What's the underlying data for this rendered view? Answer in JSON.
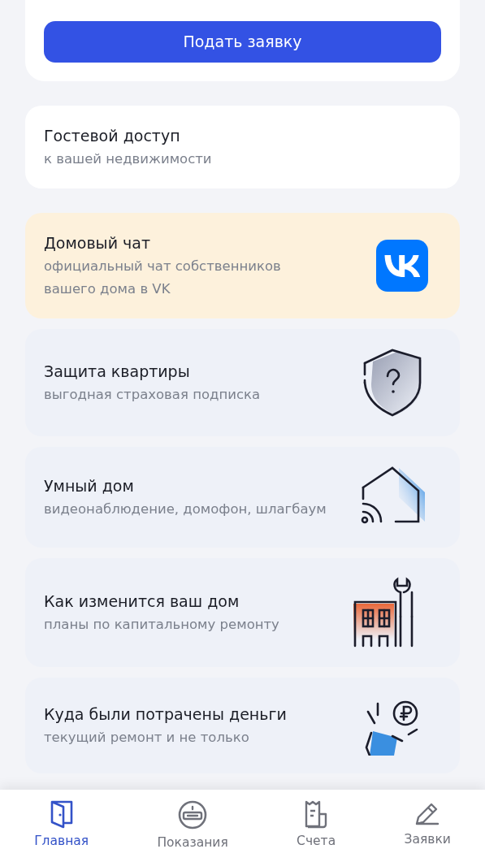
{
  "apply_button": "Подать заявку",
  "cards": [
    {
      "kind": "guest",
      "title": "Гостевой доступ",
      "subtitle": "к вашей недвижимости"
    },
    {
      "kind": "vk",
      "title": "Домовый чат",
      "subtitle": "официальный чат собственников вашего дома в VK"
    },
    {
      "kind": "shield",
      "title": "Защита квартиры",
      "subtitle": "выгодная страховая подписка"
    },
    {
      "kind": "smarthome",
      "title": "Умный дом",
      "subtitle": "видеонаблюдение, домофон, шлагбаум"
    },
    {
      "kind": "renovation",
      "title": "Как изменится ваш дом",
      "subtitle": "планы по капитальному ремонту"
    },
    {
      "kind": "money",
      "title": "Куда были потрачены деньги",
      "subtitle": "текущий ремонт и не только"
    }
  ],
  "tabs": [
    {
      "kind": "home",
      "label": "Главная",
      "selected": true
    },
    {
      "kind": "meter",
      "label": "Показания",
      "selected": false
    },
    {
      "kind": "bills",
      "label": "Счета",
      "selected": false
    },
    {
      "kind": "requests",
      "label": "Заявки",
      "selected": false
    }
  ]
}
